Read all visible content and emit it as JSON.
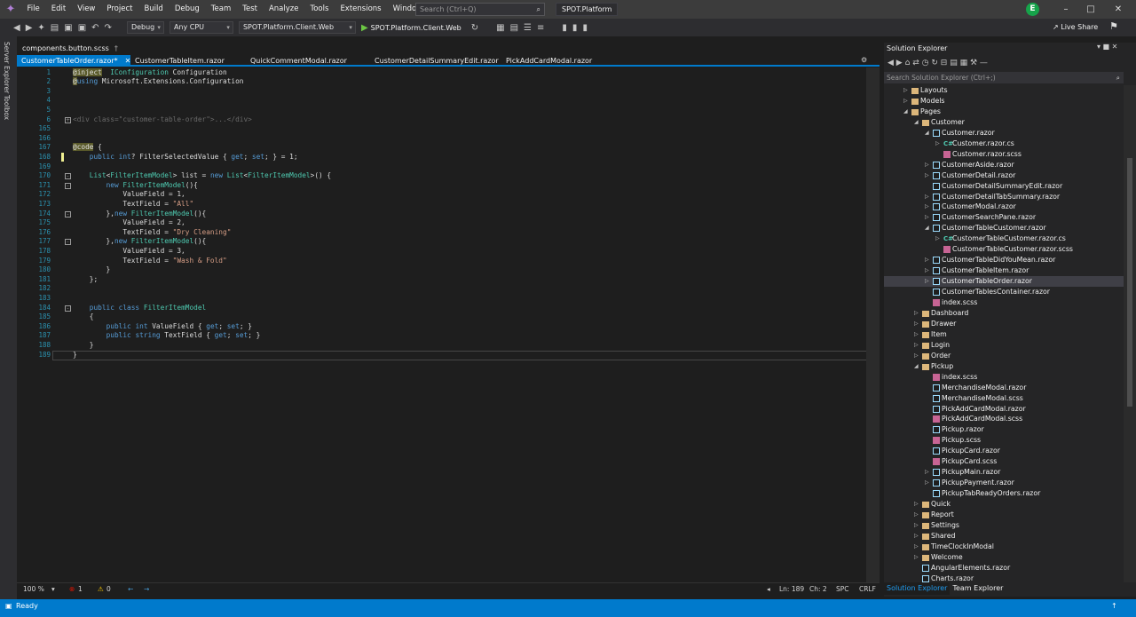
{
  "title_bar": {
    "menu": [
      "File",
      "Edit",
      "View",
      "Project",
      "Build",
      "Debug",
      "Team",
      "Test",
      "Analyze",
      "Tools",
      "Extensions",
      "Window",
      "Help"
    ],
    "search_placeholder": "Search (Ctrl+Q)",
    "solution_name": "SPOT.Platform",
    "user_initial": "E"
  },
  "toolbar": {
    "config": "Debug",
    "platform": "Any CPU",
    "project": "SPOT.Platform.Client.Web",
    "run_label": "SPOT.Platform.Client.Web",
    "live_share": "Live Share"
  },
  "left_strip": {
    "server_explorer": "Server Explorer",
    "toolbox": "Toolbox"
  },
  "tabs_row1": [
    {
      "label": "components.button.scss"
    }
  ],
  "tabs_row2": [
    {
      "label": "CustomerTableOrder.razor*"
    },
    {
      "label": "CustomerTableItem.razor"
    },
    {
      "label": "QuickCommentModal.razor"
    },
    {
      "label": "CustomerDetailSummaryEdit.razor"
    },
    {
      "label": "PickAddCardModal.razor"
    }
  ],
  "editor": {
    "lines": [
      {
        "n": "1",
        "t": [
          [
            "dir",
            "@inject"
          ],
          [
            "",
            "  "
          ],
          [
            "ty",
            "IConfiguration"
          ],
          [
            "",
            " Configuration"
          ]
        ]
      },
      {
        "n": "2",
        "t": [
          [
            "dir",
            "@"
          ],
          [
            "kw",
            "using"
          ],
          [
            "",
            " Microsoft.Extensions.Configuration"
          ]
        ]
      },
      {
        "n": "3",
        "t": []
      },
      {
        "n": "4",
        "t": []
      },
      {
        "n": "5",
        "t": []
      },
      {
        "n": "6",
        "t": [
          [
            "cm",
            "<div class=\"customer-table-order\">...</div>"
          ]
        ]
      },
      {
        "n": "165",
        "t": []
      },
      {
        "n": "166",
        "t": []
      },
      {
        "n": "167",
        "t": [
          [
            "dir",
            "@code"
          ],
          [
            "",
            " {"
          ]
        ]
      },
      {
        "n": "168",
        "t": [
          [
            "",
            "    "
          ],
          [
            "kw",
            "public"
          ],
          [
            "",
            " "
          ],
          [
            "kw",
            "int"
          ],
          [
            "",
            "? FilterSelectedValue { "
          ],
          [
            "kw",
            "get"
          ],
          [
            "",
            "; "
          ],
          [
            "kw",
            "set"
          ],
          [
            "",
            "; } = 1;"
          ]
        ]
      },
      {
        "n": "169",
        "t": []
      },
      {
        "n": "170",
        "t": [
          [
            "",
            "    "
          ],
          [
            "ty",
            "List"
          ],
          [
            "",
            "<"
          ],
          [
            "ty",
            "FilterItemModel"
          ],
          [
            "",
            "> list = "
          ],
          [
            "kw",
            "new"
          ],
          [
            "",
            " "
          ],
          [
            "ty",
            "List"
          ],
          [
            "",
            "<"
          ],
          [
            "ty",
            "FilterItemModel"
          ],
          [
            "",
            ">() {"
          ]
        ]
      },
      {
        "n": "171",
        "t": [
          [
            "",
            "        "
          ],
          [
            "kw",
            "new"
          ],
          [
            "",
            " "
          ],
          [
            "ty",
            "FilterItemModel"
          ],
          [
            "",
            "(){"
          ]
        ]
      },
      {
        "n": "172",
        "t": [
          [
            "",
            "            ValueField = 1,"
          ]
        ]
      },
      {
        "n": "173",
        "t": [
          [
            "",
            "            TextField = "
          ],
          [
            "str",
            "\"All\""
          ]
        ]
      },
      {
        "n": "174",
        "t": [
          [
            "",
            "        },"
          ],
          [
            "kw",
            "new"
          ],
          [
            "",
            " "
          ],
          [
            "ty",
            "FilterItemModel"
          ],
          [
            "",
            "(){"
          ]
        ]
      },
      {
        "n": "175",
        "t": [
          [
            "",
            "            ValueField = 2,"
          ]
        ]
      },
      {
        "n": "176",
        "t": [
          [
            "",
            "            TextField = "
          ],
          [
            "str",
            "\"Dry Cleaning\""
          ]
        ]
      },
      {
        "n": "177",
        "t": [
          [
            "",
            "        },"
          ],
          [
            "kw",
            "new"
          ],
          [
            "",
            " "
          ],
          [
            "ty",
            "FilterItemModel"
          ],
          [
            "",
            "(){"
          ]
        ]
      },
      {
        "n": "178",
        "t": [
          [
            "",
            "            ValueField = 3,"
          ]
        ]
      },
      {
        "n": "179",
        "t": [
          [
            "",
            "            TextField = "
          ],
          [
            "str",
            "\"Wash & Fold\""
          ]
        ]
      },
      {
        "n": "180",
        "t": [
          [
            "",
            "        }"
          ]
        ]
      },
      {
        "n": "181",
        "t": [
          [
            "",
            "    };"
          ]
        ]
      },
      {
        "n": "182",
        "t": []
      },
      {
        "n": "183",
        "t": []
      },
      {
        "n": "184",
        "t": [
          [
            "",
            "    "
          ],
          [
            "kw",
            "public"
          ],
          [
            "",
            " "
          ],
          [
            "kw",
            "class"
          ],
          [
            "",
            " "
          ],
          [
            "ty",
            "FilterItemModel"
          ]
        ]
      },
      {
        "n": "185",
        "t": [
          [
            "",
            "    {"
          ]
        ]
      },
      {
        "n": "186",
        "t": [
          [
            "",
            "        "
          ],
          [
            "kw",
            "public"
          ],
          [
            "",
            " "
          ],
          [
            "kw",
            "int"
          ],
          [
            "",
            " ValueField { "
          ],
          [
            "kw",
            "get"
          ],
          [
            "",
            "; "
          ],
          [
            "kw",
            "set"
          ],
          [
            "",
            "; }"
          ]
        ]
      },
      {
        "n": "187",
        "t": [
          [
            "",
            "        "
          ],
          [
            "kw",
            "public"
          ],
          [
            "",
            " "
          ],
          [
            "kw",
            "string"
          ],
          [
            "",
            " TextField { "
          ],
          [
            "kw",
            "get"
          ],
          [
            "",
            "; "
          ],
          [
            "kw",
            "set"
          ],
          [
            "",
            "; }"
          ]
        ]
      },
      {
        "n": "188",
        "t": [
          [
            "",
            "    }"
          ]
        ]
      },
      {
        "n": "189",
        "t": [
          [
            "",
            "}"
          ]
        ]
      }
    ]
  },
  "editor_status": {
    "zoom": "100 %",
    "errors": "1",
    "warnings": "0",
    "ln": "Ln: 189",
    "ch": "Ch: 2",
    "spc": "SPC",
    "crlf": "CRLF"
  },
  "solution_explorer": {
    "title": "Solution Explorer",
    "search_placeholder": "Search Solution Explorer (Ctrl+;)",
    "items": [
      {
        "label": "Layouts",
        "type": "folder",
        "indent": 2,
        "exp": "c"
      },
      {
        "label": "Models",
        "type": "folder",
        "indent": 2,
        "exp": "c"
      },
      {
        "label": "Pages",
        "type": "folder",
        "indent": 2,
        "exp": "o"
      },
      {
        "label": "Customer",
        "type": "folder",
        "indent": 3,
        "exp": "o"
      },
      {
        "label": "Customer.razor",
        "type": "file",
        "indent": 4,
        "exp": "o"
      },
      {
        "label": "Customer.razor.cs",
        "type": "cs",
        "indent": 5,
        "exp": "c"
      },
      {
        "label": "Customer.razor.scss",
        "type": "scss",
        "indent": 5,
        "exp": ""
      },
      {
        "label": "CustomerAside.razor",
        "type": "file",
        "indent": 4,
        "exp": "c"
      },
      {
        "label": "CustomerDetail.razor",
        "type": "file",
        "indent": 4,
        "exp": "c"
      },
      {
        "label": "CustomerDetailSummaryEdit.razor",
        "type": "file",
        "indent": 4,
        "exp": ""
      },
      {
        "label": "CustomerDetailTabSummary.razor",
        "type": "file",
        "indent": 4,
        "exp": "c"
      },
      {
        "label": "CustomerModal.razor",
        "type": "file",
        "indent": 4,
        "exp": "c"
      },
      {
        "label": "CustomerSearchPane.razor",
        "type": "file",
        "indent": 4,
        "exp": "c"
      },
      {
        "label": "CustomerTableCustomer.razor",
        "type": "file",
        "indent": 4,
        "exp": "o"
      },
      {
        "label": "CustomerTableCustomer.razor.cs",
        "type": "cs",
        "indent": 5,
        "exp": "c"
      },
      {
        "label": "CustomerTableCustomer.razor.scss",
        "type": "scss",
        "indent": 5,
        "exp": ""
      },
      {
        "label": "CustomerTableDidYouMean.razor",
        "type": "file",
        "indent": 4,
        "exp": "c"
      },
      {
        "label": "CustomerTableItem.razor",
        "type": "file",
        "indent": 4,
        "exp": "c"
      },
      {
        "label": "CustomerTableOrder.razor",
        "type": "file",
        "indent": 4,
        "exp": "c",
        "selected": true
      },
      {
        "label": "CustomerTablesContainer.razor",
        "type": "file",
        "indent": 4,
        "exp": ""
      },
      {
        "label": "index.scss",
        "type": "scss",
        "indent": 4,
        "exp": ""
      },
      {
        "label": "Dashboard",
        "type": "folder",
        "indent": 3,
        "exp": "c"
      },
      {
        "label": "Drawer",
        "type": "folder",
        "indent": 3,
        "exp": "c"
      },
      {
        "label": "Item",
        "type": "folder",
        "indent": 3,
        "exp": "c"
      },
      {
        "label": "Login",
        "type": "folder",
        "indent": 3,
        "exp": "c"
      },
      {
        "label": "Order",
        "type": "folder",
        "indent": 3,
        "exp": "c"
      },
      {
        "label": "Pickup",
        "type": "folder",
        "indent": 3,
        "exp": "o"
      },
      {
        "label": "index.scss",
        "type": "scss",
        "indent": 4,
        "exp": ""
      },
      {
        "label": "MerchandiseModal.razor",
        "type": "file",
        "indent": 4,
        "exp": ""
      },
      {
        "label": "MerchandiseModal.scss",
        "type": "file",
        "indent": 4,
        "exp": ""
      },
      {
        "label": "PickAddCardModal.razor",
        "type": "file",
        "indent": 4,
        "exp": ""
      },
      {
        "label": "PickAddCardModal.scss",
        "type": "scss",
        "indent": 4,
        "exp": ""
      },
      {
        "label": "Pickup.razor",
        "type": "file",
        "indent": 4,
        "exp": ""
      },
      {
        "label": "Pickup.scss",
        "type": "scss",
        "indent": 4,
        "exp": ""
      },
      {
        "label": "PickupCard.razor",
        "type": "file",
        "indent": 4,
        "exp": ""
      },
      {
        "label": "PickupCard.scss",
        "type": "scss",
        "indent": 4,
        "exp": ""
      },
      {
        "label": "PickupMain.razor",
        "type": "file",
        "indent": 4,
        "exp": "c"
      },
      {
        "label": "PickupPayment.razor",
        "type": "file",
        "indent": 4,
        "exp": "c"
      },
      {
        "label": "PickupTabReadyOrders.razor",
        "type": "file",
        "indent": 4,
        "exp": ""
      },
      {
        "label": "Quick",
        "type": "folder",
        "indent": 3,
        "exp": "c"
      },
      {
        "label": "Report",
        "type": "folder",
        "indent": 3,
        "exp": "c"
      },
      {
        "label": "Settings",
        "type": "folder",
        "indent": 3,
        "exp": "c"
      },
      {
        "label": "Shared",
        "type": "folder",
        "indent": 3,
        "exp": "c"
      },
      {
        "label": "TimeClockInModal",
        "type": "folder",
        "indent": 3,
        "exp": "c"
      },
      {
        "label": "Welcome",
        "type": "folder",
        "indent": 3,
        "exp": "c"
      },
      {
        "label": "AngularElements.razor",
        "type": "file",
        "indent": 3,
        "exp": ""
      },
      {
        "label": "Charts.razor",
        "type": "file",
        "indent": 3,
        "exp": ""
      }
    ],
    "bottom_tabs": [
      "Solution Explorer",
      "Team Explorer"
    ]
  },
  "status_bar": {
    "text": "Ready"
  },
  "colors": {
    "accent": "#007acc",
    "folder": "#dcb67a"
  }
}
